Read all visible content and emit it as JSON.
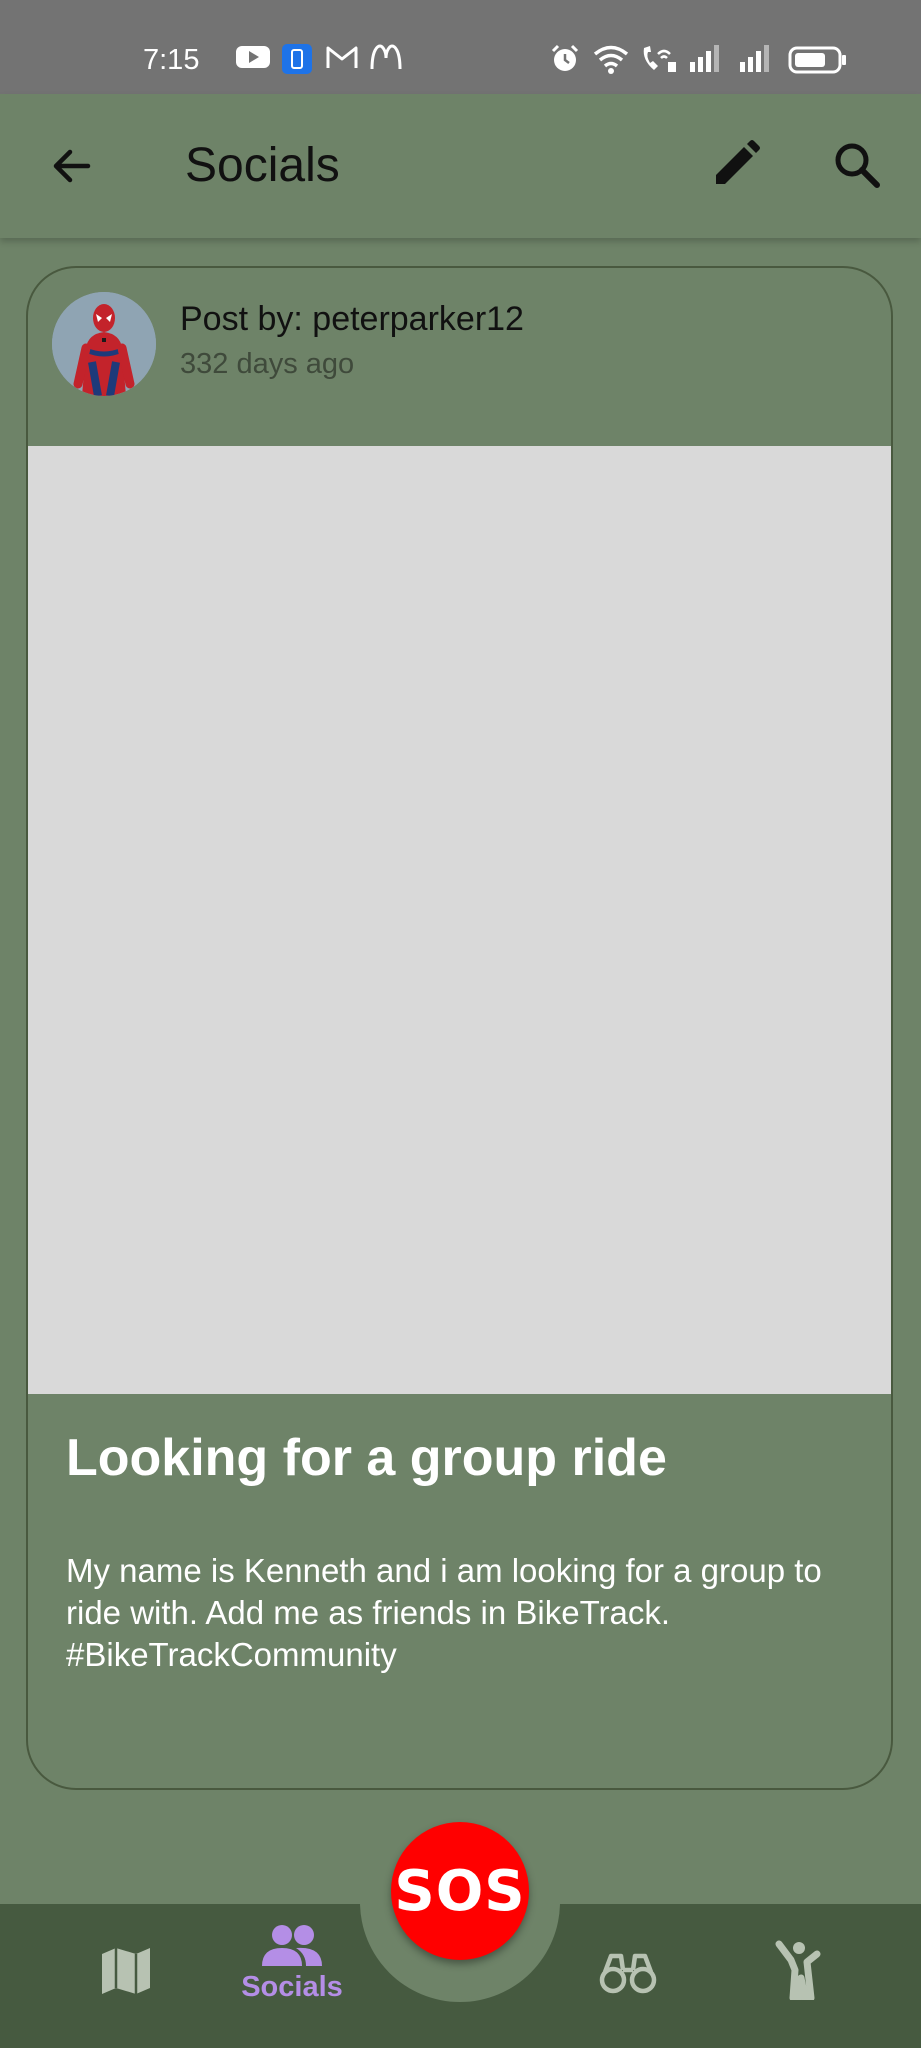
{
  "status_bar": {
    "time": "7:15",
    "icons_left": [
      "youtube-icon",
      "phone-app-icon",
      "gmail-icon",
      "mcdonalds-icon"
    ],
    "icons_right": [
      "alarm-icon",
      "wifi-icon",
      "wifi-calling-icon",
      "signal-icon",
      "signal-icon",
      "battery-icon"
    ]
  },
  "app_bar": {
    "title": "Socials",
    "back_icon": "arrow-back-icon",
    "edit_icon": "edit-pencil-icon",
    "search_icon": "search-icon"
  },
  "post": {
    "author": "Post by: peterparker12",
    "age": "332 days ago",
    "title": "Looking for a group ride",
    "body": "My name is Kenneth and i am looking for a group to ride with. Add me as friends in BikeTrack. #BikeTrackCommunity"
  },
  "bottom_nav": {
    "items": [
      {
        "icon": "map-icon",
        "label": ""
      },
      {
        "icon": "people-icon",
        "label": "Socials",
        "active": true
      },
      {
        "icon": "binoculars-icon",
        "label": ""
      },
      {
        "icon": "person-waving-icon",
        "label": ""
      }
    ],
    "sos_label": "SOS"
  },
  "colors": {
    "background": "#6e8368",
    "nav_background": "#465a40",
    "active_nav": "#b48ee6",
    "sos": "#ff0000",
    "image_placeholder": "#d9d9d9"
  }
}
